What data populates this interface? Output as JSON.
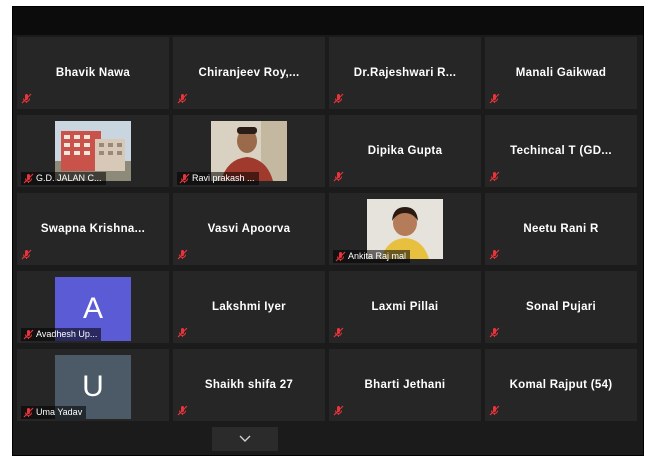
{
  "colors": {
    "background": "#1b1b1b",
    "tile": "#262626",
    "muted_mic": "#e8343a",
    "avatar_blue": "#5b5bd6",
    "avatar_slate": "#4b5a66"
  },
  "participants": [
    {
      "name": "Bhavik Nawa"
    },
    {
      "name": "Chiranjeev  Roy,..."
    },
    {
      "name": "Dr.Rajeshwari  R..."
    },
    {
      "name": "Manali Gaikwad"
    },
    {
      "name": "G.D. JALAN C..."
    },
    {
      "name": "Ravi prakash ..."
    },
    {
      "name": "Dipika Gupta"
    },
    {
      "name": "Techincal T (GD..."
    },
    {
      "name": "Swapna  Krishna..."
    },
    {
      "name": "Vasvi Apoorva"
    },
    {
      "name": "Ankita Raj mal"
    },
    {
      "name": "Neetu Rani R"
    },
    {
      "name": "Avadhesh Up...",
      "initial": "A"
    },
    {
      "name": "Lakshmi Iyer"
    },
    {
      "name": "Laxmi Pillai"
    },
    {
      "name": "Sonal Pujari"
    },
    {
      "name": "Uma Yadav",
      "initial": "U"
    },
    {
      "name": "Shaikh shifa 27"
    },
    {
      "name": "Bharti Jethani"
    },
    {
      "name": "Komal Rajput (54)"
    }
  ],
  "icons": {
    "mic_muted": "mic-muted-icon",
    "more": "chevron-down-icon"
  }
}
